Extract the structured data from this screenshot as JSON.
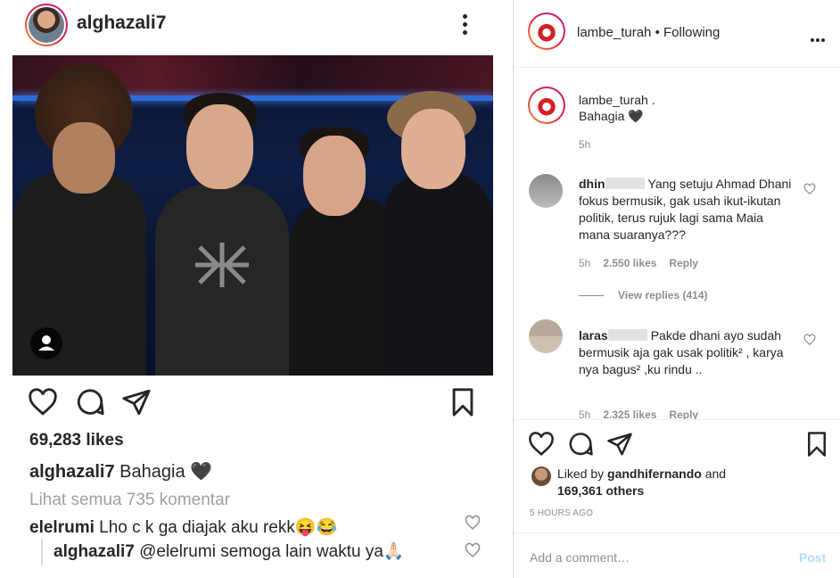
{
  "left_post": {
    "username": "alghazali7",
    "likes": "69,283 likes",
    "caption_user": "alghazali7",
    "caption_text": "Bahagia 🖤",
    "view_all": "Lihat semua 735 komentar",
    "comment_user": "elelrumi",
    "comment_text": "Lho c k ga diajak aku rekk😝😂",
    "reply_user": "alghazali7",
    "reply_text": "@elelrumi semoga lain waktu ya🙏🏻"
  },
  "right_post": {
    "username": "lambe_turah",
    "follow_status": "• Following",
    "caption_user": "lambe_turah .",
    "caption_text": "Bahagia 🖤",
    "caption_time": "5h",
    "comments": [
      {
        "user": "dhin",
        "text": "Yang setuju Ahmad Dhani fokus bermusik, gak usah ikut-ikutan politik, terus rujuk lagi sama Maia mana suaranya???",
        "time": "5h",
        "likes": "2.550 likes",
        "reply": "Reply",
        "view_replies": "View replies (414)"
      },
      {
        "user": "laras",
        "text": "Pakde dhani ayo sudah bermusik aja gak usak politik² , karya nya bagus² ,ku rindu ..",
        "time": "5h",
        "likes": "2.325 likes",
        "reply": "Reply"
      }
    ],
    "liked_by_prefix": "Liked by",
    "liked_by_user": "gandhifernando",
    "liked_by_suffix": "and",
    "liked_others": "169,361 others",
    "timestamp": "5 HOURS AGO",
    "add_comment_placeholder": "Add a comment…",
    "post_button": "Post"
  },
  "icons": [
    "heart-icon",
    "comment-icon",
    "share-icon",
    "bookmark-icon",
    "more-icon",
    "user-tag-icon"
  ]
}
